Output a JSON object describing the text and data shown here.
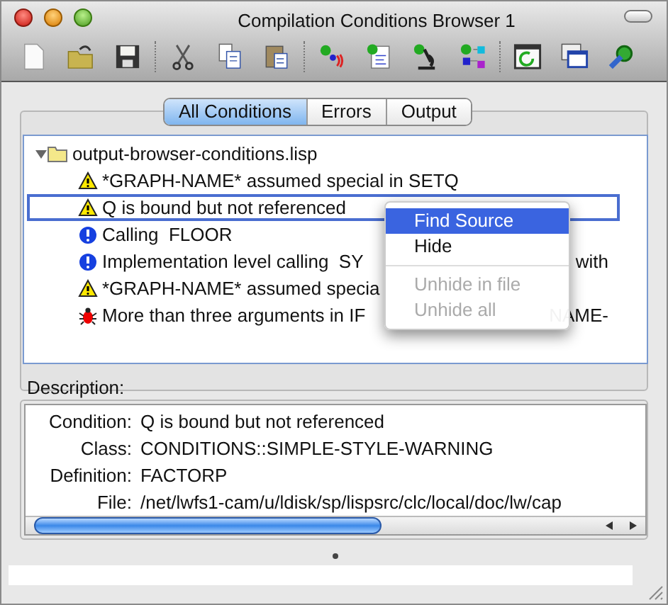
{
  "window": {
    "title": "Compilation Conditions Browser 1"
  },
  "tabs": [
    {
      "label": "All Conditions",
      "selected": true
    },
    {
      "label": "Errors",
      "selected": false
    },
    {
      "label": "Output",
      "selected": false
    }
  ],
  "tree": {
    "label": "output-browser-conditions.lisp",
    "expanded": true,
    "children": [
      {
        "kind": "warning",
        "text": "*GRAPH-NAME* assumed special in SETQ",
        "selected": false
      },
      {
        "kind": "warning",
        "text": "Q is bound but not referenced",
        "selected": true
      },
      {
        "kind": "info",
        "text": "Calling  FLOOR",
        "selected": false
      },
      {
        "kind": "info",
        "text": "Implementation level calling  SY",
        "text_after_menu": "with",
        "selected": false
      },
      {
        "kind": "warning",
        "text": "*GRAPH-NAME* assumed specia",
        "selected": false
      },
      {
        "kind": "error",
        "text": "More than three arguments in IF",
        "text_after_menu": "NAME-",
        "selected": false
      }
    ]
  },
  "context_menu": [
    {
      "label": "Find Source",
      "highlighted": true,
      "disabled": false
    },
    {
      "label": "Hide",
      "highlighted": false,
      "disabled": false
    },
    {
      "kind": "separator"
    },
    {
      "label": "Unhide in file",
      "highlighted": false,
      "disabled": true
    },
    {
      "label": "Unhide all",
      "highlighted": false,
      "disabled": true
    }
  ],
  "description": {
    "label": "Description:",
    "fields": [
      {
        "name": "Condition:",
        "value": "Q is bound but not referenced"
      },
      {
        "name": "Class:",
        "value": "CONDITIONS::SIMPLE-STYLE-WARNING"
      },
      {
        "name": "Definition:",
        "value": "FACTORP"
      },
      {
        "name": "File:",
        "value": "/net/lwfs1-cam/u/ldisk/sp/lispsrc/clc/local/doc/lw/cap"
      }
    ]
  }
}
